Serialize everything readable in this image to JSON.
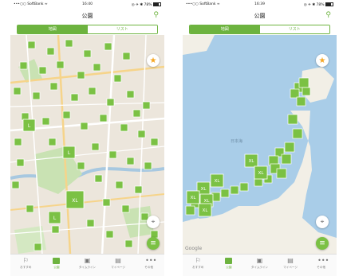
{
  "status": {
    "carrier": "•••○○ SoftBank ≈",
    "battery": "78%"
  },
  "left": {
    "time": "16:40",
    "title": "公園",
    "tabs": [
      "地図",
      "リスト"
    ],
    "active_tab": 0
  },
  "right": {
    "time": "16:39",
    "title": "公園",
    "tabs": [
      "地図",
      "リスト"
    ],
    "active_tab": 0,
    "map_label": "日本海",
    "google": "Google"
  },
  "tabbar": {
    "items": [
      "おすすめ",
      "公園",
      "タイムライン",
      "マイページ",
      "その他"
    ],
    "active": 1
  },
  "colors": {
    "accent": "#6db33f",
    "marker": "#7bc144",
    "star": "#f5a623"
  },
  "markers": {
    "size_label_xl": "XL",
    "size_label_l": "L"
  },
  "icons": {
    "search": "search-icon",
    "star": "star-icon",
    "locate": "locate-icon",
    "menu": "menu-icon"
  }
}
